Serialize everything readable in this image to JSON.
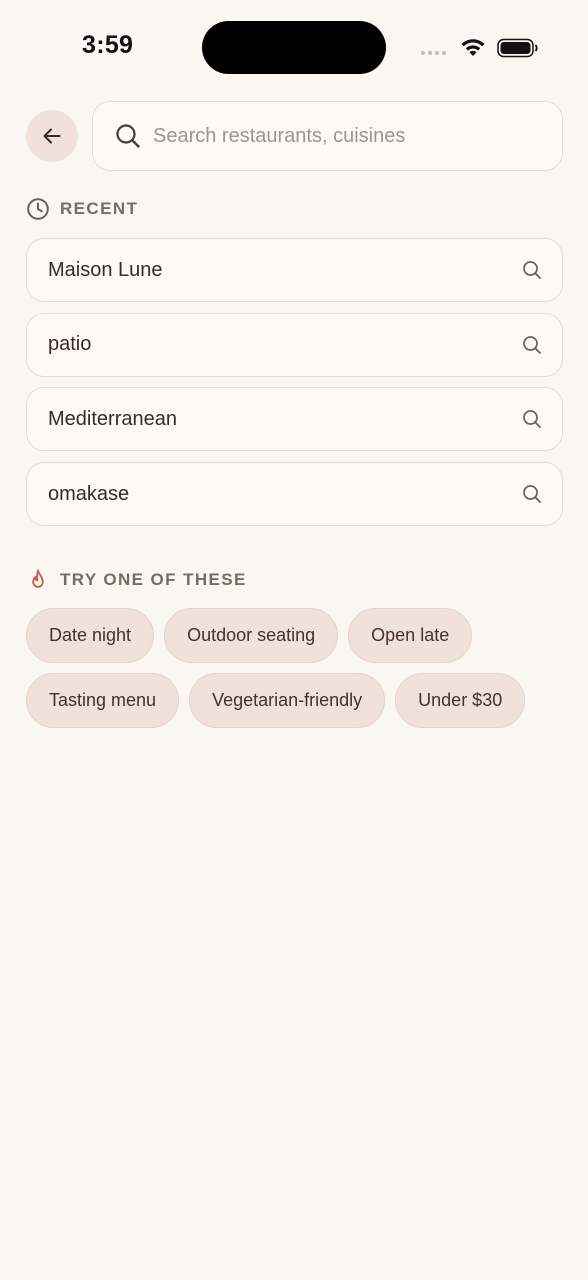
{
  "status_bar": {
    "time": "3:59"
  },
  "search": {
    "placeholder": "Search restaurants, cuisines",
    "value": ""
  },
  "recent": {
    "label": "RECENT",
    "items": [
      "Maison Lune",
      "patio",
      "Mediterranean",
      "omakase"
    ]
  },
  "suggestions": {
    "label": "TRY ONE OF THESE",
    "chips": [
      "Date night",
      "Outdoor seating",
      "Open late",
      "Tasting menu",
      "Vegetarian-friendly",
      "Under $30"
    ]
  },
  "icons": {
    "back": "arrow-left-icon",
    "search": "search-icon",
    "recent": "clock-icon",
    "suggestions": "flame-icon"
  },
  "colors": {
    "background": "#FAF6F1",
    "chip_background": "#F0E1DB",
    "accent": "#C4624A",
    "text": "#3A2A26",
    "muted": "#7A6A64"
  }
}
